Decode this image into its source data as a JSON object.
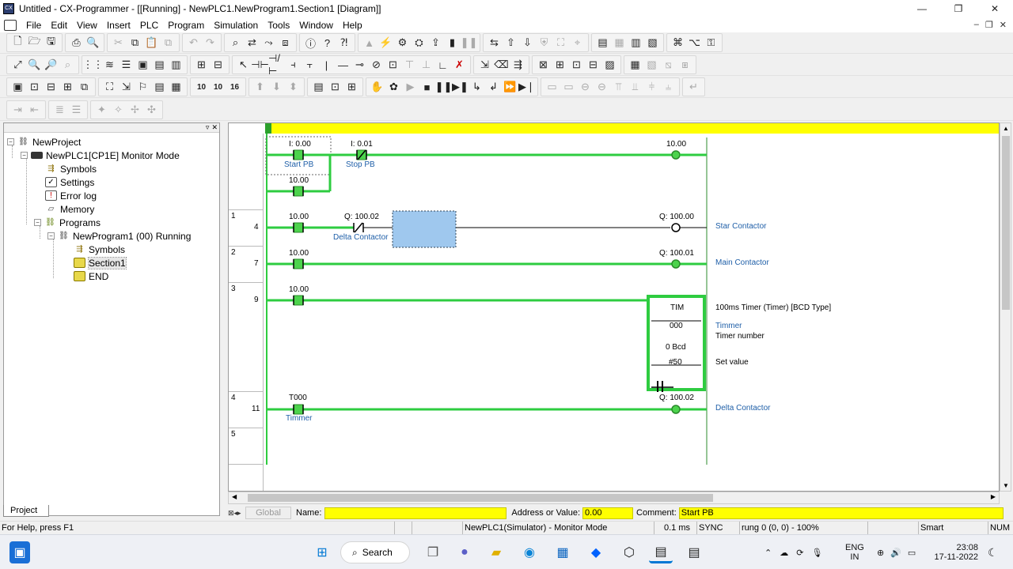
{
  "window": {
    "title": "Untitled - CX-Programmer - [[Running] - NewPLC1.NewProgram1.Section1 [Diagram]]",
    "minimize": "—",
    "restore": "❐",
    "close": "✕"
  },
  "menu": [
    "File",
    "Edit",
    "View",
    "Insert",
    "PLC",
    "Program",
    "Simulation",
    "Tools",
    "Window",
    "Help"
  ],
  "project_tree": {
    "items": [
      {
        "label": "NewProject",
        "icon": "project-icon"
      },
      {
        "label": "NewPLC1[CP1E] Monitor Mode",
        "icon": "plc-icon"
      },
      {
        "label": "Symbols",
        "icon": "symbols-icon"
      },
      {
        "label": "Settings",
        "icon": "settings-icon"
      },
      {
        "label": "Error log",
        "icon": "error-log-icon"
      },
      {
        "label": "Memory",
        "icon": "memory-icon"
      },
      {
        "label": "Programs",
        "icon": "programs-icon"
      },
      {
        "label": "NewProgram1 (00) Running",
        "icon": "program-icon"
      },
      {
        "label": "Symbols",
        "icon": "symbols-icon"
      },
      {
        "label": "Section1",
        "icon": "section-icon"
      },
      {
        "label": "END",
        "icon": "end-icon"
      }
    ],
    "tab_label": "Project"
  },
  "diagram": {
    "rungs": [
      {
        "num": "",
        "step": ""
      },
      {
        "num": "1",
        "step": "4"
      },
      {
        "num": "2",
        "step": "7"
      },
      {
        "num": "3",
        "step": "9"
      },
      {
        "num": "4",
        "step": "11"
      },
      {
        "num": "5",
        "step": ""
      }
    ],
    "labels": {
      "r0_c1_addr": "I: 0.00",
      "r0_c1_name": "Start PB",
      "r0_c2_addr": "I: 0.01",
      "r0_c2_name": "Stop PB",
      "r0_out_addr": "10.00",
      "r0_seal_addr": "10.00",
      "r1_c1_addr": "10.00",
      "r1_c2_addr": "Q: 100.02",
      "r1_c2_name": "Delta Contactor",
      "r1_out_addr": "Q: 100.00",
      "r1_out_name": "Star Contactor",
      "r2_c1_addr": "10.00",
      "r2_out_addr": "Q: 100.01",
      "r2_out_name": "Main Contactor",
      "r3_c1_addr": "10.00",
      "tim_name": "TIM",
      "tim_num": "000",
      "tim_bcd": "0 Bcd",
      "tim_set": "#50",
      "tim_desc": "100ms Timer (Timer) [BCD Type]",
      "tim_sym": "Timmer",
      "tim_num_label": "Timer number",
      "tim_set_label": "Set value",
      "r4_c1_addr": "T000",
      "r4_c1_name": "Timmer",
      "r4_out_addr": "Q: 100.02",
      "r4_out_name": "Delta Contactor"
    }
  },
  "namebar": {
    "global": "Global",
    "name_label": "Name:",
    "name_value": "",
    "addr_label": "Address or Value:",
    "addr_value": "0.00",
    "comment_label": "Comment:",
    "comment_value": "Start PB"
  },
  "status": {
    "help": "For Help, press F1",
    "plc": "NewPLC1(Simulator) - Monitor Mode",
    "time": "0.1 ms",
    "sync": "SYNC",
    "rung": "rung 0 (0, 0)  - 100%",
    "smart": "Smart",
    "num": "NUM"
  },
  "taskbar": {
    "search": "Search",
    "lang1": "ENG",
    "lang2": "IN",
    "time": "23:08",
    "date": "17-11-2022"
  },
  "colors": {
    "power_green": "#2ecc40",
    "contact_green": "#4cd34c",
    "yellow": "#ffff00",
    "selection_blue": "#9fc8ee",
    "label_blue": "#1f5fa8"
  }
}
